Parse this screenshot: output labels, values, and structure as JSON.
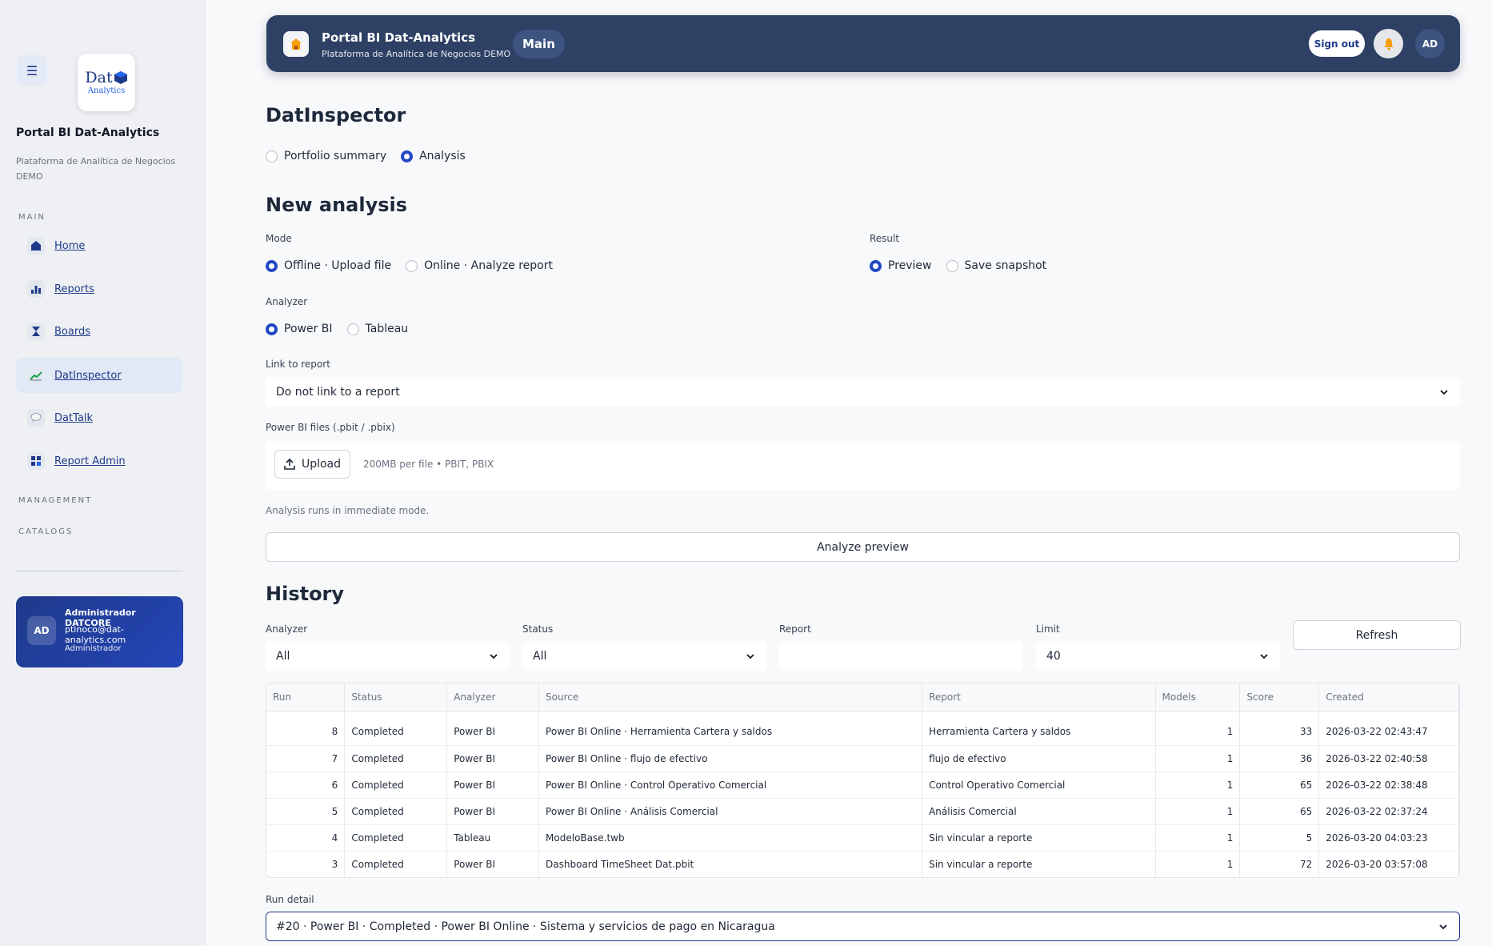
{
  "sidebar": {
    "title": "Portal BI Dat-Analytics",
    "subtitle": "Plataforma de Analítica de Negocios DEMO",
    "logo": {
      "main": "Dat",
      "sub": "Analytics"
    },
    "sections": {
      "main": "MAIN",
      "management": "MANAGEMENT",
      "catalogs": "CATALOGS"
    },
    "items": [
      {
        "label": "Home",
        "icon": "house-icon"
      },
      {
        "label": "Reports",
        "icon": "bar-chart-icon"
      },
      {
        "label": "Boards",
        "icon": "hourglass-icon"
      },
      {
        "label": "DatInspector",
        "icon": "trend-icon"
      },
      {
        "label": "DatTalk",
        "icon": "chat-icon"
      },
      {
        "label": "Report Admin",
        "icon": "grid-icon"
      }
    ],
    "user": {
      "initials": "AD",
      "name": "Administrador DATCORE",
      "email": "ptinoco@dat-analytics.com",
      "role": "Administrador"
    }
  },
  "topbar": {
    "title": "Portal BI Dat-Analytics",
    "subtitle": "Plataforma de Analítica de Negocios DEMO",
    "pill": "Main",
    "signout": "Sign out",
    "avatar": "AD"
  },
  "page": {
    "title": "DatInspector",
    "view_options": [
      "Portfolio summary",
      "Analysis"
    ],
    "view_selected": "Analysis"
  },
  "new_analysis": {
    "title": "New analysis",
    "mode_label": "Mode",
    "mode_options": [
      "Offline · Upload file",
      "Online · Analyze report"
    ],
    "result_label": "Result",
    "result_options": [
      "Preview",
      "Save snapshot"
    ],
    "analyzer_label": "Analyzer",
    "analyzer_options": [
      "Power BI",
      "Tableau"
    ],
    "link_label": "Link to report",
    "link_value": "Do not link to a report",
    "files_label": "Power BI files (.pbit / .pbix)",
    "upload_label": "Upload",
    "upload_hint": "200MB per file • PBIT, PBIX",
    "note": "Analysis runs in immediate mode.",
    "analyze_button": "Analyze preview"
  },
  "history": {
    "title": "History",
    "filters": {
      "analyzer_label": "Analyzer",
      "analyzer_value": "All",
      "status_label": "Status",
      "status_value": "All",
      "report_label": "Report",
      "report_value": "",
      "limit_label": "Limit",
      "limit_value": "40"
    },
    "refresh": "Refresh",
    "columns": [
      "Run",
      "Status",
      "Analyzer",
      "Source",
      "Report",
      "Models",
      "Score",
      "Created"
    ],
    "rows": [
      [
        "8",
        "Completed",
        "Power BI",
        "Power BI Online · Herramienta Cartera y saldos",
        "Herramienta Cartera y saldos",
        "1",
        "33",
        "2026-03-22 02:43:47"
      ],
      [
        "7",
        "Completed",
        "Power BI",
        "Power BI Online · flujo de efectivo",
        "flujo de efectivo",
        "1",
        "36",
        "2026-03-22 02:40:58"
      ],
      [
        "6",
        "Completed",
        "Power BI",
        "Power BI Online · Control Operativo Comercial",
        "Control Operativo Comercial",
        "1",
        "65",
        "2026-03-22 02:38:48"
      ],
      [
        "5",
        "Completed",
        "Power BI",
        "Power BI Online · Análisis Comercial",
        "Análisis Comercial",
        "1",
        "65",
        "2026-03-22 02:37:24"
      ],
      [
        "4",
        "Completed",
        "Tableau",
        "ModeloBase.twb",
        "Sin vincular a reporte",
        "1",
        "5",
        "2026-03-20 04:03:23"
      ],
      [
        "3",
        "Completed",
        "Power BI",
        "Dashboard TimeSheet Dat.pbit",
        "Sin vincular a reporte",
        "1",
        "72",
        "2026-03-20 03:57:08"
      ]
    ],
    "detail_label": "Run detail",
    "detail_value": "#20 · Power BI · Completed · Power BI Online · Sistema y servicios de pago en Nicaragua"
  }
}
